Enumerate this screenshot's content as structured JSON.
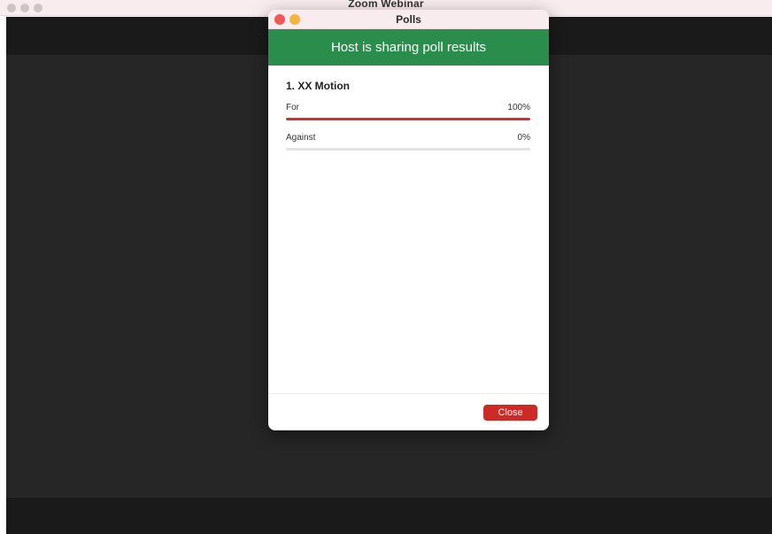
{
  "main_window": {
    "title": "Zoom Webinar"
  },
  "dialog": {
    "title": "Polls",
    "banner": "Host is sharing poll results",
    "question": "1. XX Motion",
    "options": [
      {
        "label": "For",
        "percent_text": "100%",
        "percent": 100
      },
      {
        "label": "Against",
        "percent_text": "0%",
        "percent": 0
      }
    ],
    "close_label": "Close"
  },
  "colors": {
    "banner_green": "#2b8d4c",
    "bar_red": "#d0312e",
    "close_red": "#cb2a25"
  }
}
